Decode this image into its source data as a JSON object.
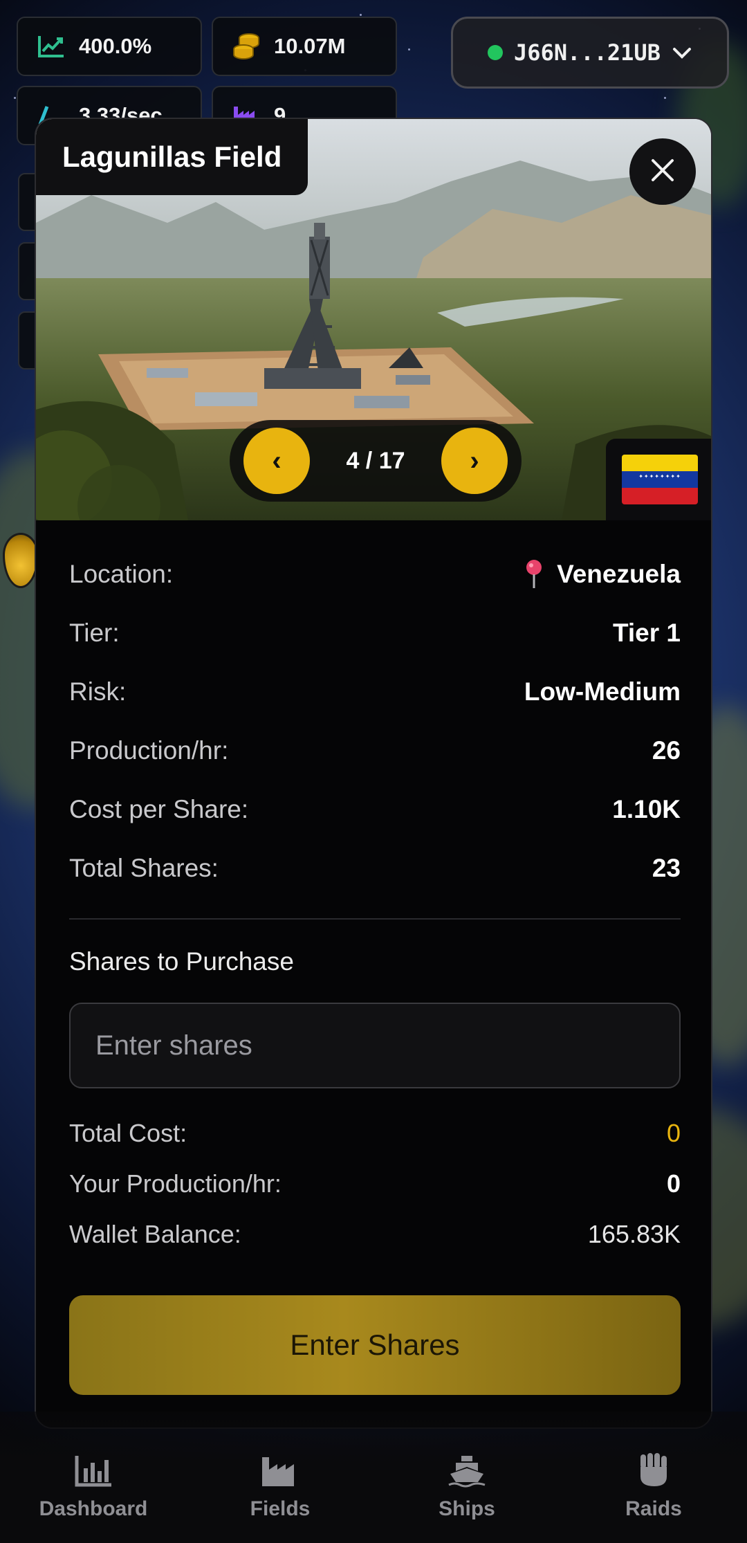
{
  "top_stats": {
    "percent": "400.0%",
    "coins": "10.07M",
    "rate": "3.33/sec",
    "count": "9"
  },
  "wallet": {
    "address": "J66N...21UB",
    "status_color": "#22c55e"
  },
  "modal": {
    "title": "Lagunillas Field",
    "pager": {
      "prev": "‹",
      "next": "›",
      "current": "4 / 17"
    },
    "details": [
      {
        "label": "Location:",
        "value": "Venezuela"
      },
      {
        "label": "Tier:",
        "value": "Tier 1"
      },
      {
        "label": "Risk:",
        "value": "Low-Medium"
      },
      {
        "label": "Production/hr:",
        "value": "26"
      },
      {
        "label": "Cost per Share:",
        "value": "1.10K"
      },
      {
        "label": "Total Shares:",
        "value": "23"
      }
    ],
    "purchase": {
      "label": "Shares to Purchase",
      "placeholder": "Enter shares",
      "value": ""
    },
    "summary": [
      {
        "label": "Total Cost:",
        "value": "0"
      },
      {
        "label": "Your Production/hr:",
        "value": "0"
      },
      {
        "label": "Wallet Balance:",
        "value": "165.83K"
      }
    ],
    "submit_label": "Enter Shares"
  },
  "nav": [
    {
      "label": "Dashboard",
      "icon": "bar-chart-icon"
    },
    {
      "label": "Fields",
      "icon": "factory-icon"
    },
    {
      "label": "Ships",
      "icon": "ship-icon"
    },
    {
      "label": "Raids",
      "icon": "fist-icon"
    }
  ],
  "colors": {
    "accent": "#e8b40f",
    "button": "#a8891d",
    "panel": "#050506",
    "success": "#22c55e"
  }
}
